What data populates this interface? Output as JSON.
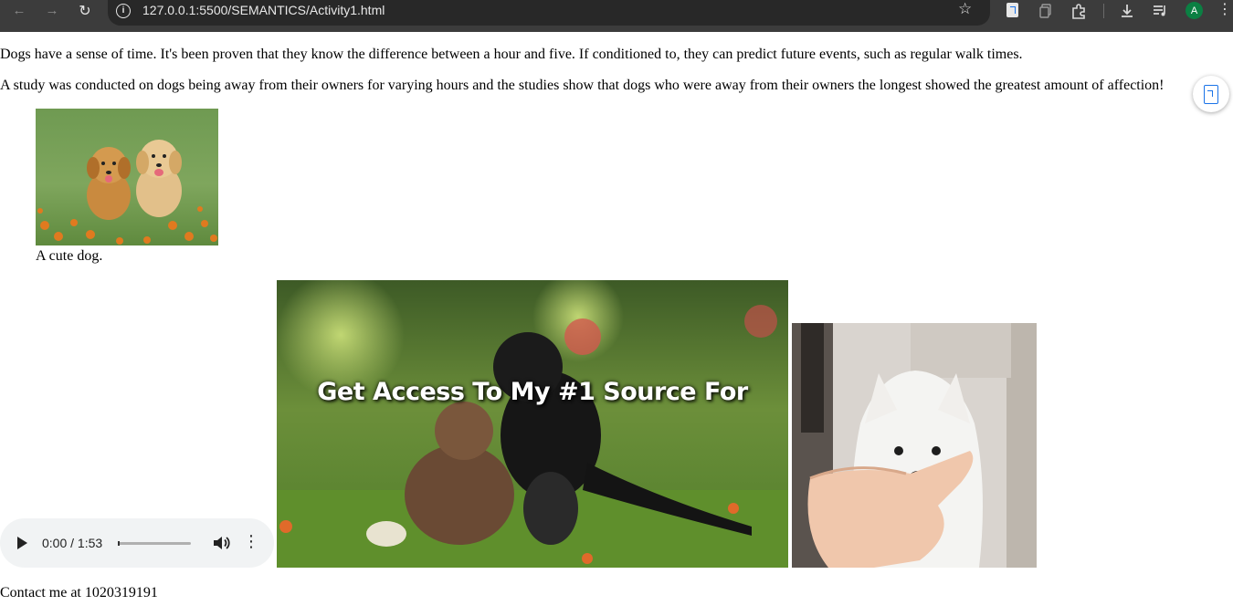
{
  "browser": {
    "url": "127.0.0.1:5500/SEMANTICS/Activity1.html",
    "avatar_initial": "A",
    "icons": [
      "back-arrow-icon",
      "forward-arrow-icon",
      "reload-icon",
      "site-info-icon",
      "bookmark-star-icon",
      "extension-doc-icon",
      "copy-page-icon",
      "puzzle-extensions-icon",
      "download-icon",
      "media-queue-icon",
      "profile-avatar",
      "kebab-menu-icon"
    ]
  },
  "content": {
    "paragraph_1": "Dogs have a sense of time. It's been proven that they know the difference between a hour and five. If conditioned to, they can predict future events, such as regular walk times.",
    "paragraph_2": "A study was conducted on dogs being away from their owners for varying hours and the studies show that dogs who were away from their owners the longest showed the greatest amount of affection!",
    "figure_caption": "A cute dog.",
    "audio_time": "0:00 / 1:53",
    "audio_progress": 0,
    "video_overlay_text": "Get Access To My #1 Source For",
    "contact": "Contact me at 1020319191"
  },
  "colors": {
    "chrome_bg": "#3c3c3c",
    "omnibox_bg": "#282828",
    "accent_blue": "#1a73e8",
    "avatar_green": "#0b8043",
    "audio_bg": "#f1f3f4"
  }
}
